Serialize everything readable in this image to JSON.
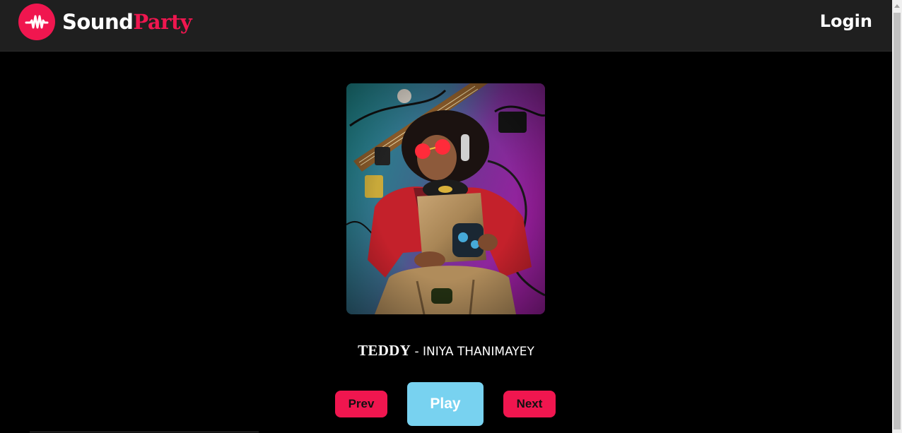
{
  "window": {
    "background": "#000000",
    "navbar_background": "#1f1f1f",
    "accent": "#f0164f",
    "play_color": "#78d2f0"
  },
  "brand": {
    "part1": "Sound",
    "part2": "Party",
    "logo_icon": "waveform-icon"
  },
  "nav": {
    "login_label": "Login"
  },
  "player": {
    "cover_alt": "album-cover-image",
    "title": "TEDDY",
    "separator": " - ",
    "artist": "INIYA THANIMAYEY",
    "prev_label": "Prev",
    "play_label": "Play",
    "next_label": "Next"
  }
}
